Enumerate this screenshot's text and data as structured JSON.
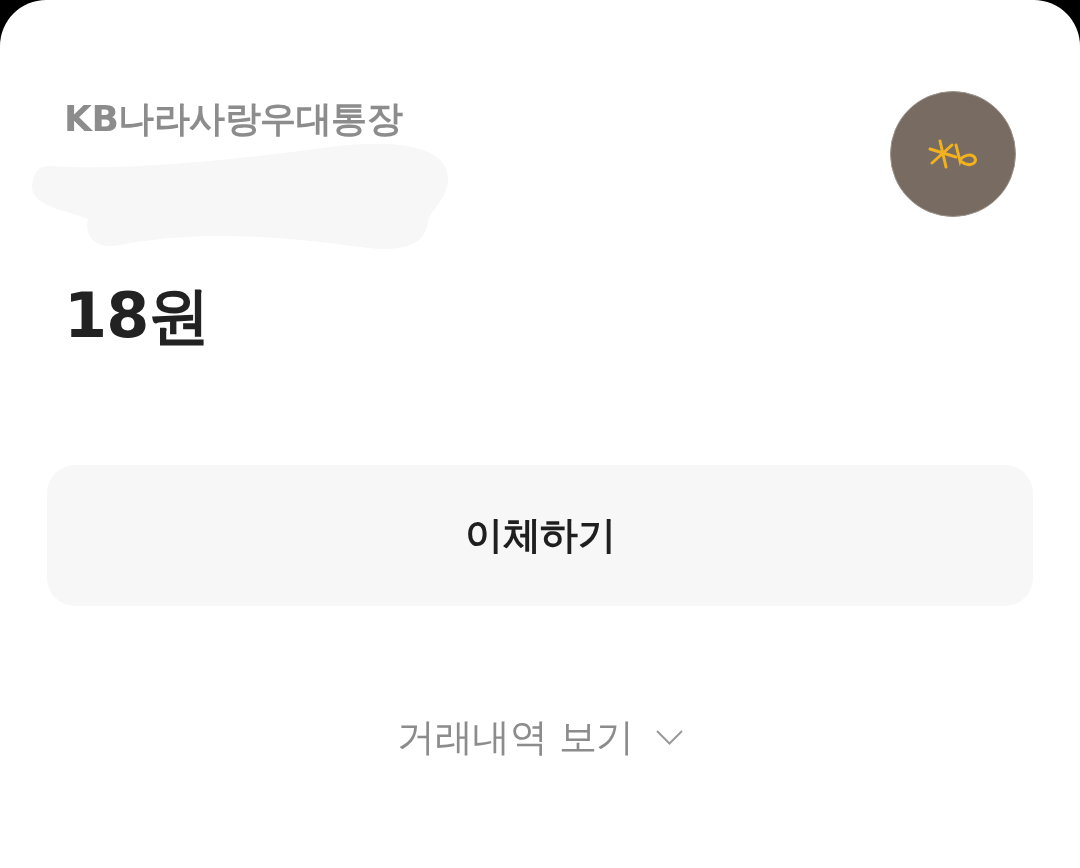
{
  "account": {
    "name": "KB나라사랑우대통장",
    "balance": "18원"
  },
  "transfer_button": {
    "label": "이체하기"
  },
  "history_link": {
    "label": "거래내역 보기"
  }
}
